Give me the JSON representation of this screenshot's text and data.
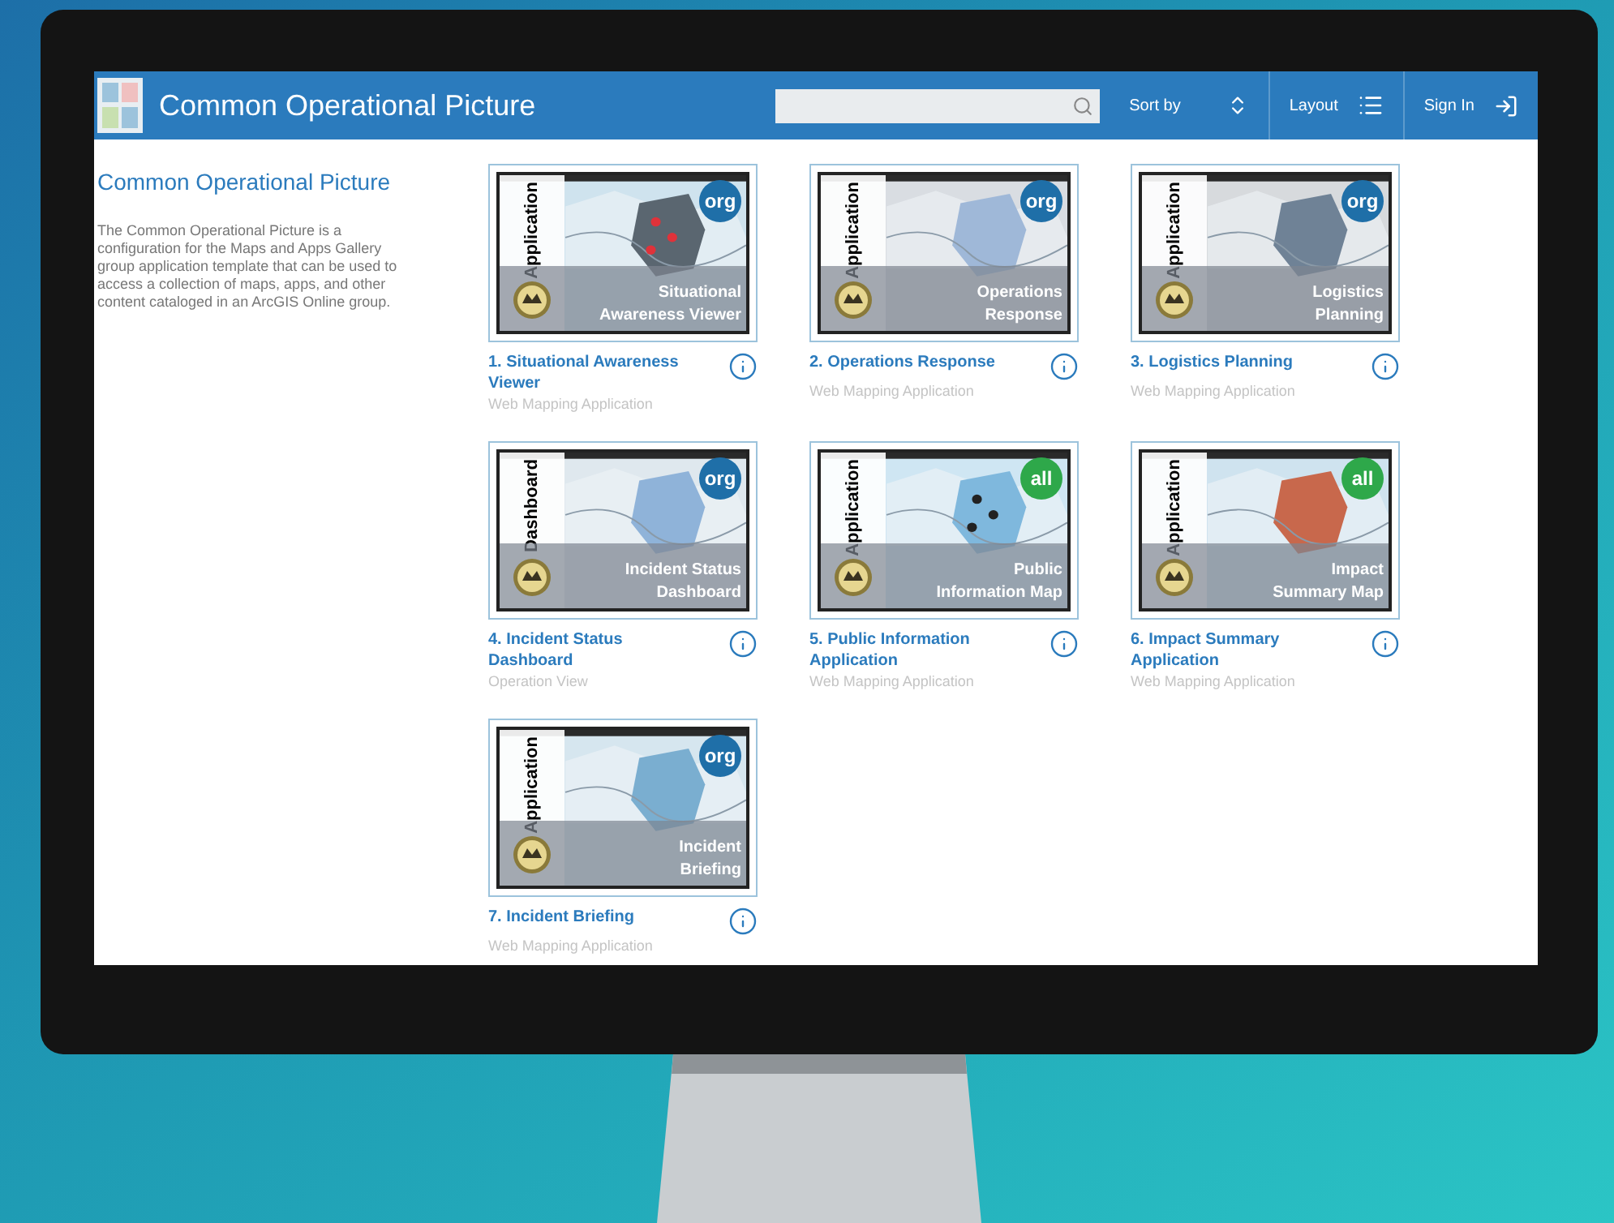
{
  "header": {
    "title": "Common Operational Picture",
    "sort": "Sort by",
    "layout": "Layout",
    "sign_in": "Sign In"
  },
  "sidebar": {
    "title": "Common Operational Picture",
    "description": "The Common Operational Picture is a configuration for the Maps and Apps Gallery group application template that can be used to access a collection of maps, apps, and other content cataloged in an ArcGIS Online group."
  },
  "items": [
    {
      "type_label": "Application",
      "badge": "org",
      "color": "#1f6fa8",
      "overlay": [
        "Situational",
        "Awareness Viewer"
      ],
      "title": "1. Situational Awareness Viewer",
      "subtitle": "Web Mapping Application"
    },
    {
      "type_label": "Application",
      "badge": "org",
      "color": "#1f6fa8",
      "overlay": [
        "Operations",
        "Response"
      ],
      "title": "2. Operations Response",
      "subtitle": "Web Mapping Application"
    },
    {
      "type_label": "Application",
      "badge": "org",
      "color": "#1f6fa8",
      "overlay": [
        "Logistics",
        "Planning"
      ],
      "title": "3. Logistics Planning",
      "subtitle": "Web Mapping Application"
    },
    {
      "type_label": "Dashboard",
      "badge": "org",
      "color": "#1f6fa8",
      "overlay": [
        "Incident Status",
        "Dashboard"
      ],
      "title": "4. Incident Status Dashboard",
      "subtitle": "Operation View"
    },
    {
      "type_label": "Application",
      "badge": "all",
      "color": "#2ea84a",
      "overlay": [
        "Public",
        "Information Map"
      ],
      "title": "5. Public Information Application",
      "subtitle": "Web Mapping Application"
    },
    {
      "type_label": "Application",
      "badge": "all",
      "color": "#2ea84a",
      "overlay": [
        "Impact",
        "Summary Map"
      ],
      "title": "6. Impact Summary Application",
      "subtitle": "Web Mapping Application"
    },
    {
      "type_label": "Application",
      "badge": "org",
      "color": "#1f6fa8",
      "overlay": [
        "Incident",
        "Briefing"
      ],
      "title": "7. Incident Briefing",
      "subtitle": "Web Mapping Application"
    }
  ]
}
